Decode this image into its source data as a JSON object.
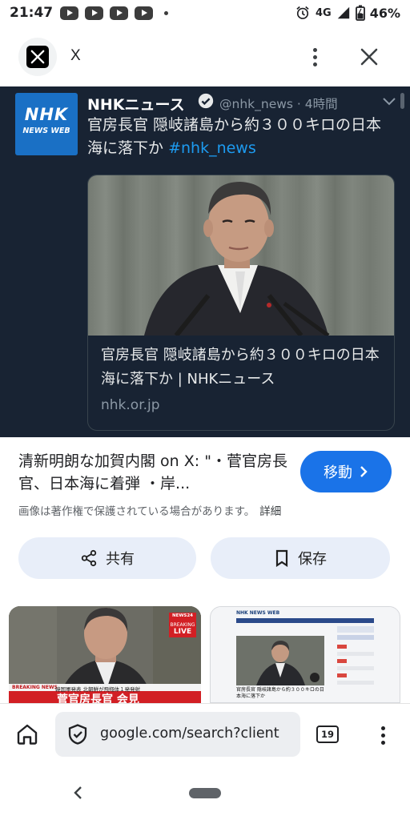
{
  "status_bar": {
    "time": "21:47",
    "network": "4G",
    "battery": "46%",
    "notification_icons": [
      "youtube-icon",
      "youtube-icon",
      "youtube-icon",
      "youtube-icon"
    ]
  },
  "header": {
    "site_name": "X"
  },
  "tweet": {
    "display_name": "NHKニュース",
    "handle_time": "@nhk_news · 4時間",
    "text_main": "官房長官 隠岐諸島から約３００キロの日本海に落下か",
    "hashtag": "#nhk_news",
    "logo_line1": "NHK",
    "logo_line2": "NEWS WEB",
    "card_title": "官房長官 隠岐諸島から約３００キロの日本海に落下か | NHKニュース",
    "card_domain": "nhk.or.jp"
  },
  "result": {
    "title": "清新明朗な加賀内閣 on X: \"・菅官房長官、日本海に着弾 ・岸...",
    "goto_label": "移動",
    "copyright_note": "画像は著作権で保護されている場合があります。",
    "details_link": "詳細",
    "share_label": "共有",
    "save_label": "保存"
  },
  "thumbnails": {
    "t1_badge": "NEWS24",
    "t1_breaking": "BREAKING",
    "t1_live": "LIVE",
    "t1_ticker_label": "BREAKING NEWS",
    "t1_ticker": "韓国軍発表 北朝鮮が飛翔体１発発射",
    "t1_caption": "菅官房長官 会見",
    "t2_logo": "NHK NEWS WEB",
    "t2_caption": "官房長官 隠岐諸島から約３００キロの日本海に落下か"
  },
  "browser": {
    "url": "google.com/search?client",
    "tab_count": "19"
  },
  "colors": {
    "accent": "#1a73e8",
    "image_bg": "#182333",
    "nhk_blue": "#1a70c5",
    "pill_bg": "#e8eef9",
    "hashtag": "#1d9bf0"
  }
}
